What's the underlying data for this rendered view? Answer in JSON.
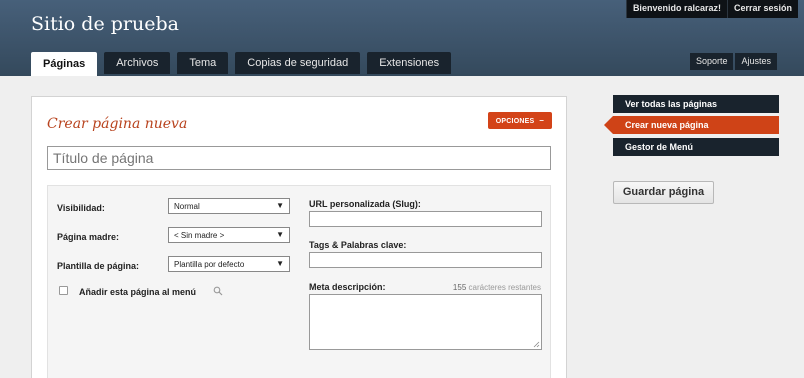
{
  "header": {
    "site_title": "Sitio de prueba",
    "top_links": [
      "Bienvenido ralcaraz!",
      "Cerrar sesión"
    ],
    "tabs": [
      {
        "label": "Páginas",
        "active": true
      },
      {
        "label": "Archivos",
        "active": false
      },
      {
        "label": "Tema",
        "active": false
      },
      {
        "label": "Copias de seguridad",
        "active": false
      },
      {
        "label": "Extensiones",
        "active": false
      }
    ],
    "util_links": [
      "Soporte",
      "Ajustes"
    ]
  },
  "main": {
    "heading": "Crear página nueva",
    "options_label": "OPCIONES",
    "title_placeholder": "Título de página",
    "visibility": {
      "label": "Visibilidad:",
      "value": "Normal"
    },
    "parent": {
      "label": "Página madre:",
      "value": "< Sin madre >"
    },
    "template": {
      "label": "Plantilla de página:",
      "value": "Plantilla por defecto"
    },
    "add_to_menu_label": "Añadir esta página al menú",
    "slug_label": "URL personalizada (Slug):",
    "tags_label": "Tags & Palabras clave:",
    "meta_label": "Meta descripción:",
    "meta_remaining_count": "155",
    "meta_remaining_text": "carácteres restantes"
  },
  "sidebar": {
    "items": [
      {
        "label": "Ver todas las páginas",
        "active": false
      },
      {
        "label": "Crear nueva página",
        "active": true
      },
      {
        "label": "Gestor de Menú",
        "active": false
      }
    ],
    "save_label": "Guardar página"
  },
  "colors": {
    "accent": "#cf4317",
    "header": "#3d5369",
    "dark_nav": "#19232d"
  }
}
